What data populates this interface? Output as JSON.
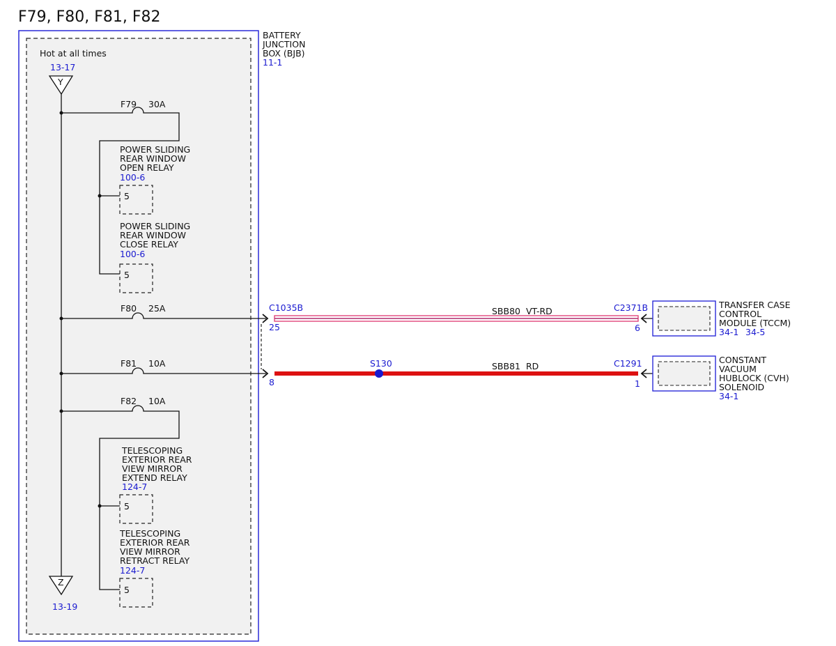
{
  "title": "F79, F80, F81, F82",
  "bjb": {
    "name_lines": [
      "BATTERY",
      "JUNCTION",
      "BOX (BJB)"
    ],
    "ref": "11-1",
    "hot_label": "Hot at all times"
  },
  "connectors": {
    "top": {
      "letter": "Y",
      "ref": "13-17"
    },
    "bottom": {
      "letter": "Z",
      "ref": "13-19"
    }
  },
  "fuses": {
    "f79": {
      "id": "F79",
      "rating": "30A"
    },
    "f80": {
      "id": "F80",
      "rating": "25A"
    },
    "f81": {
      "id": "F81",
      "rating": "10A"
    },
    "f82": {
      "id": "F82",
      "rating": "10A"
    }
  },
  "relays": [
    {
      "lines": [
        "POWER SLIDING",
        "REAR WINDOW",
        "OPEN RELAY"
      ],
      "ref": "100-6",
      "pin": "5"
    },
    {
      "lines": [
        "POWER SLIDING",
        "REAR WINDOW",
        "CLOSE RELAY"
      ],
      "ref": "100-6",
      "pin": "5"
    },
    {
      "lines": [
        "TELESCOPING",
        "EXTERIOR REAR",
        "VIEW MIRROR",
        "EXTEND RELAY"
      ],
      "ref": "124-7",
      "pin": "5"
    },
    {
      "lines": [
        "TELESCOPING",
        "EXTERIOR REAR",
        "VIEW MIRROR",
        "RETRACT RELAY"
      ],
      "ref": "124-7",
      "pin": "5"
    }
  ],
  "circuits": {
    "c1": {
      "connector_from": "C1035B",
      "pin_from": "25",
      "wire_label": "SBB80  VT-RD",
      "connector_to": "C2371B",
      "pin_to": "6",
      "color": "#e0457a"
    },
    "c2": {
      "connector_from": "",
      "pin_from": "8",
      "splice": "S130",
      "wire_label": "SBB81  RD",
      "connector_to": "C1291",
      "pin_to": "1",
      "color": "#dd1111"
    }
  },
  "components": {
    "tccm": {
      "lines": [
        "TRANSFER CASE",
        "CONTROL",
        "MODULE (TCCM)"
      ],
      "refs": [
        "34-1",
        "34-5"
      ]
    },
    "cvh": {
      "lines": [
        "CONSTANT",
        "VACUUM",
        "HUBLOCK (CVH)",
        "SOLENOID"
      ],
      "refs": [
        "34-1"
      ]
    }
  }
}
